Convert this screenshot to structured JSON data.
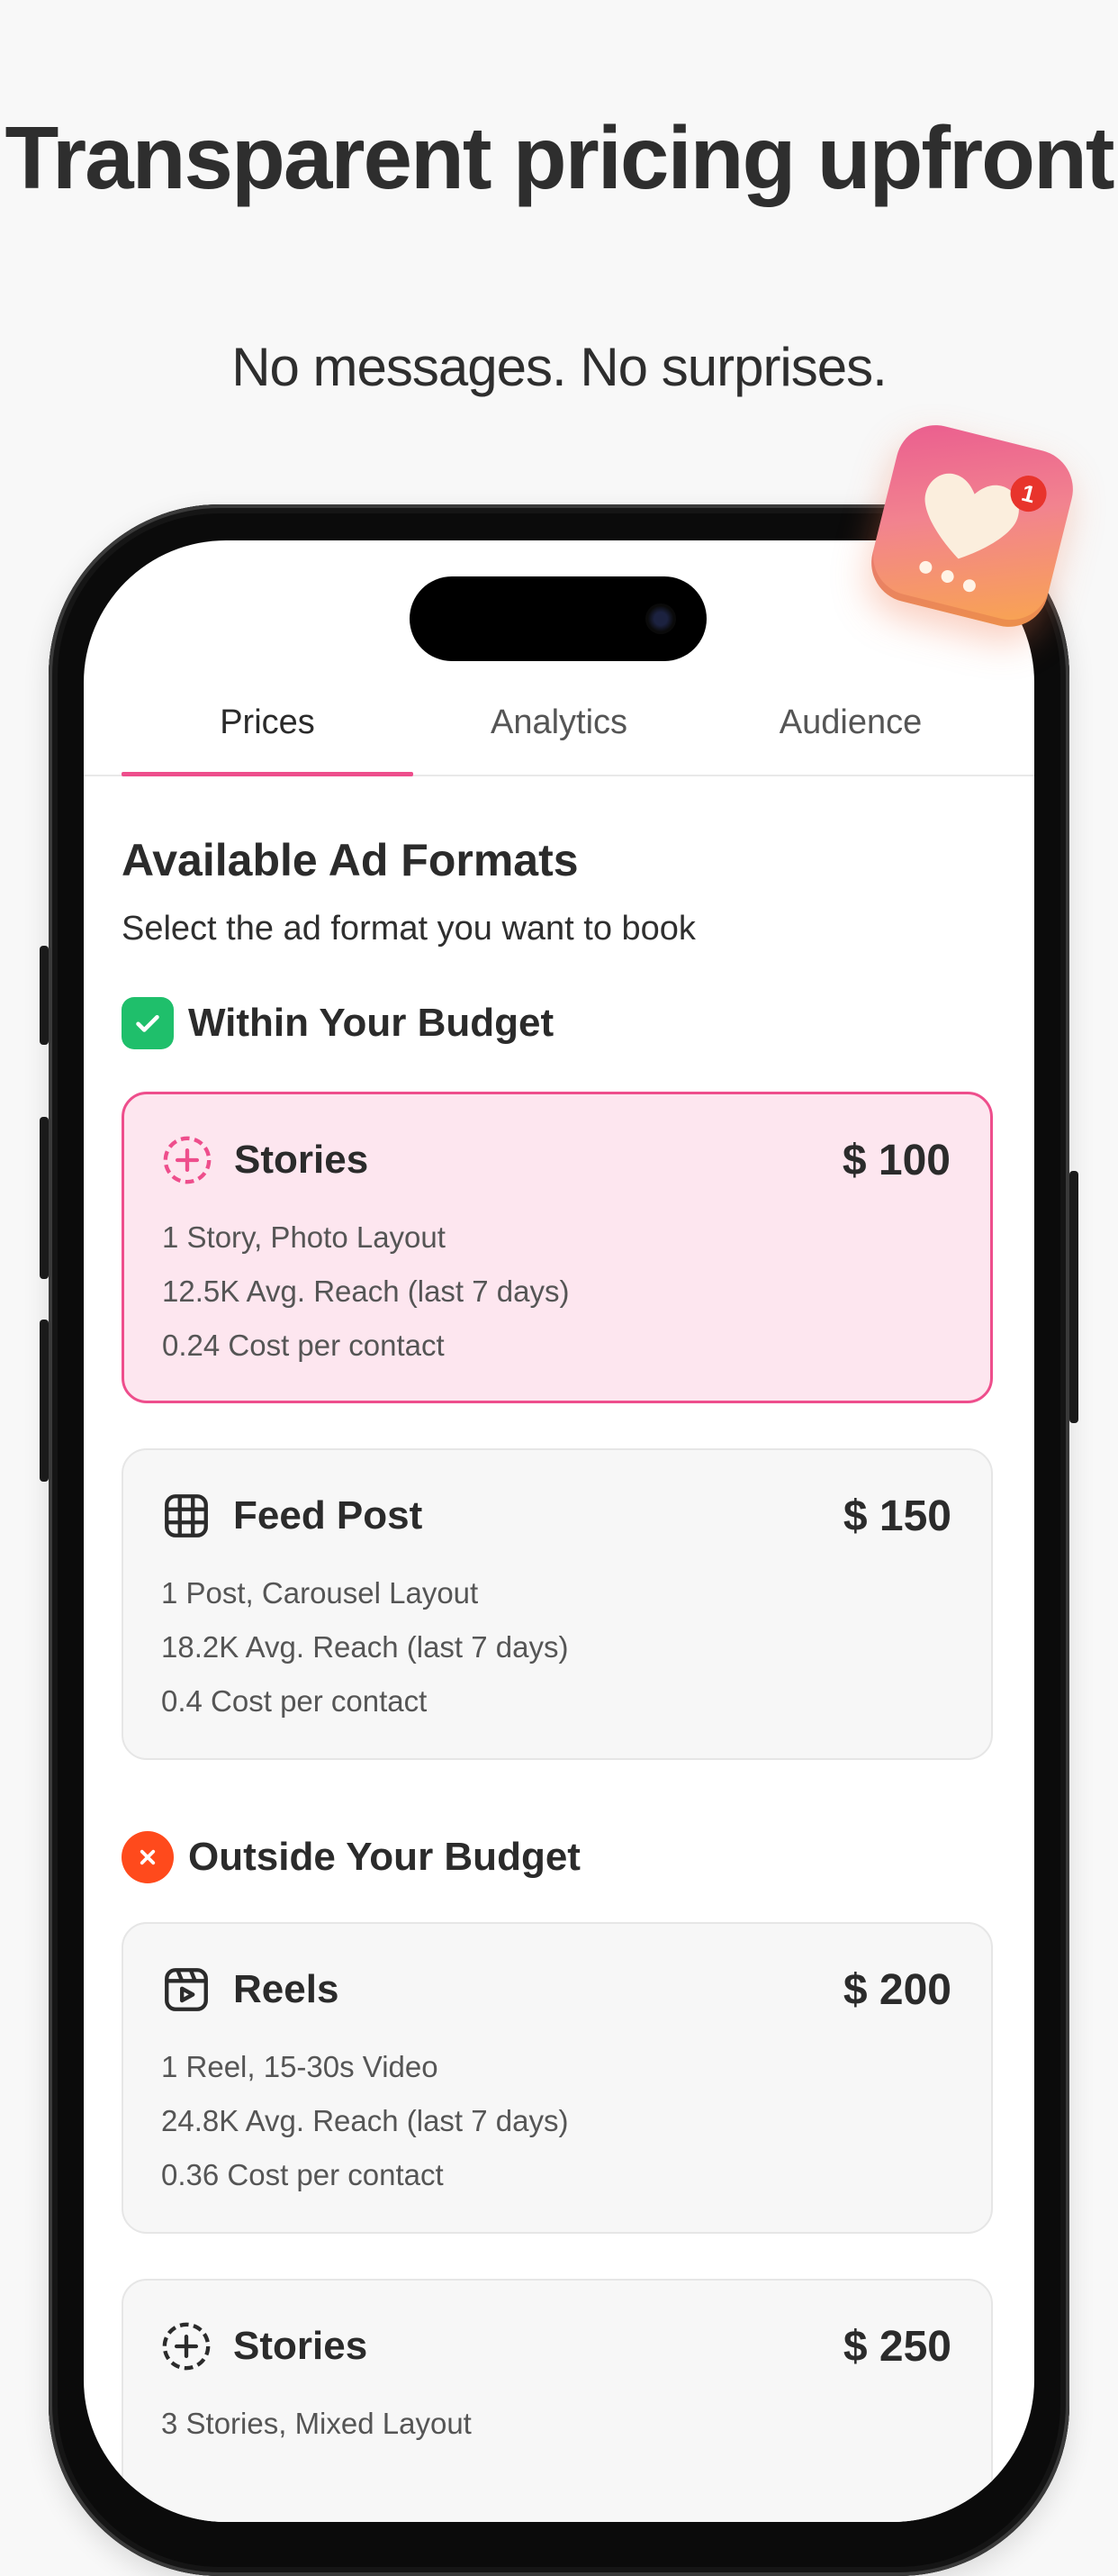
{
  "headline": "Transparent pricing upfront",
  "subheadline": "No messages. No surprises.",
  "badge": {
    "icon": "heart-icon",
    "count": "1"
  },
  "tabs": [
    {
      "label": "Prices",
      "active": true
    },
    {
      "label": "Analytics",
      "active": false
    },
    {
      "label": "Audience",
      "active": false
    }
  ],
  "section": {
    "title": "Available Ad Formats",
    "subtitle": "Select the ad format you want to book"
  },
  "groups": {
    "within": {
      "label": "Within Your Budget",
      "icon": "check-icon"
    },
    "outside": {
      "label": "Outside Your Budget",
      "icon": "x-icon"
    }
  },
  "cards": [
    {
      "icon": "story-plus-icon",
      "name": "Stories",
      "price": "$ 100",
      "selected": true,
      "lines": [
        "1 Story, Photo Layout",
        "12.5K Avg. Reach (last 7 days)",
        "0.24 Cost per contact"
      ]
    },
    {
      "icon": "grid-icon",
      "name": "Feed Post",
      "price": "$ 150",
      "selected": false,
      "lines": [
        "1 Post, Carousel Layout",
        "18.2K Avg. Reach (last 7 days)",
        "0.4 Cost per contact"
      ]
    },
    {
      "icon": "reel-icon",
      "name": "Reels",
      "price": "$ 200",
      "selected": false,
      "lines": [
        "1 Reel, 15-30s Video",
        "24.8K Avg. Reach (last 7 days)",
        "0.36 Cost per contact"
      ]
    },
    {
      "icon": "story-plus-icon",
      "name": "Stories",
      "price": "$ 250",
      "selected": false,
      "lines": [
        "3 Stories, Mixed Layout"
      ]
    }
  ],
  "colors": {
    "accent": "#ee4e8c",
    "success": "#1fbf6b",
    "danger": "#ff4a1c",
    "selected_bg": "#fde6ef"
  }
}
